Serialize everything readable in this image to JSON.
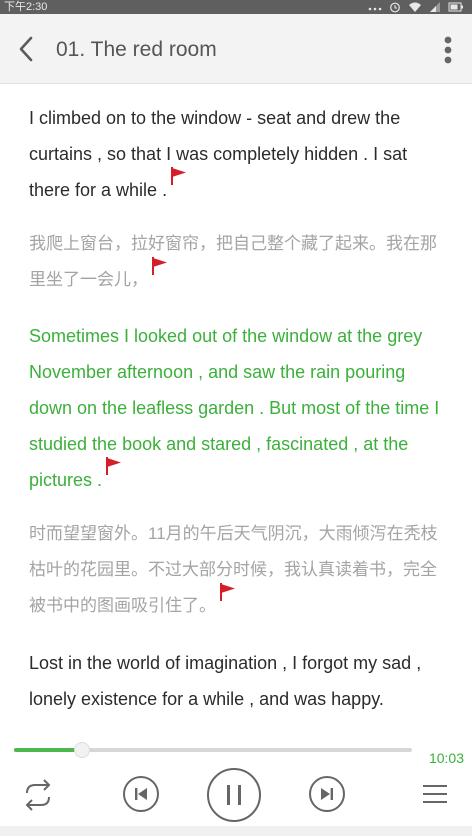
{
  "status_bar": {
    "time": "下午2:30"
  },
  "header": {
    "title": "01. The red room"
  },
  "paragraphs": [
    {
      "lang": "en",
      "highlighted": false,
      "text": "I climbed on to the window - seat and drew the curtains , so that I was completely hidden . I sat there for a while ."
    },
    {
      "lang": "zh",
      "highlighted": false,
      "text": "我爬上窗台，拉好窗帘，把自己整个藏了起来。我在那里坐了一会儿，"
    },
    {
      "lang": "en",
      "highlighted": true,
      "text": "Sometimes I looked out of the window at the grey November afternoon , and saw the rain pouring down on the leafless garden . But most of the time I studied the book and stared , fascinated , at the pictures ."
    },
    {
      "lang": "zh",
      "highlighted": false,
      "text": "时而望望窗外。11月的午后天气阴沉，大雨倾泻在秃枝枯叶的花园里。不过大部分时候，我认真读着书，完全被书中的图画吸引住了。"
    },
    {
      "lang": "en",
      "highlighted": false,
      "text": "Lost in the world of imagination , I forgot my sad , lonely existence for a while , and was happy."
    }
  ],
  "player": {
    "progress": 0.17,
    "duration": "10:03"
  },
  "colors": {
    "accent": "#3bb03b",
    "header_bg": "#f3f3f3",
    "flag": "#d41f2b",
    "chinese_text": "#a4a4a4"
  },
  "icons": {
    "back": "chevron-left-icon",
    "menu": "more-vertical-icon",
    "flag": "flag-icon",
    "repeat": "repeat-icon",
    "previous": "skip-previous-icon",
    "pause": "pause-icon",
    "next": "skip-next-icon",
    "playlist": "playlist-icon"
  }
}
